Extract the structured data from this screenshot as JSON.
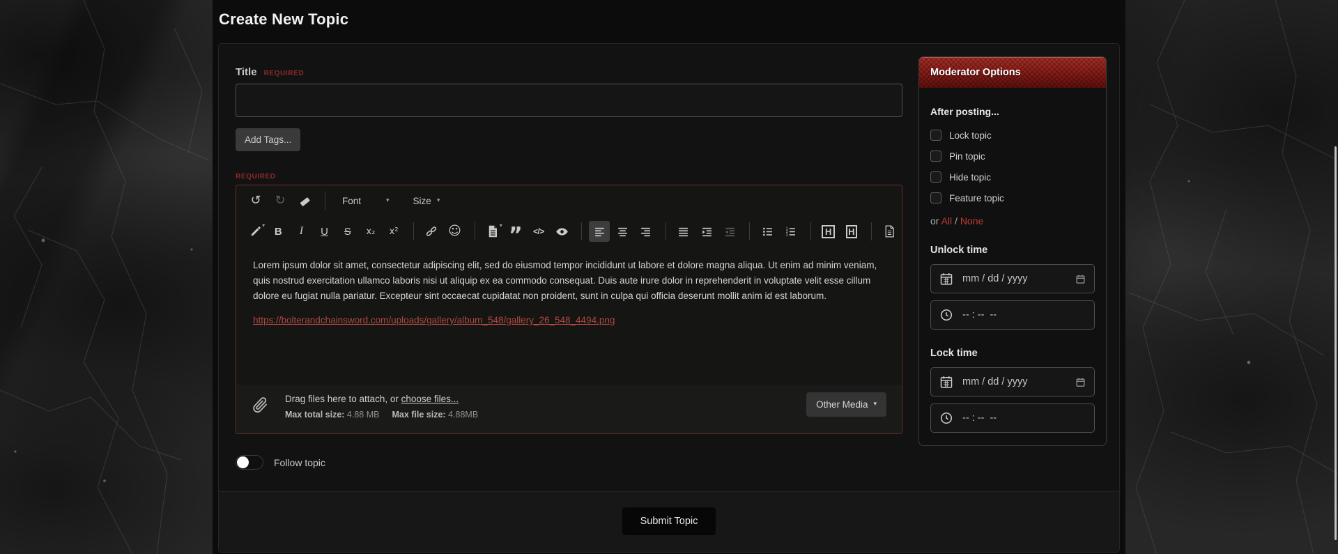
{
  "page": {
    "title": "Create New Topic"
  },
  "icons": {
    "caret_glyph": "▾",
    "undo_glyph": "↺",
    "redo_glyph": "↻",
    "emoji_glyph": "☺",
    "quote_glyph": "”"
  },
  "form": {
    "title_label": "Title",
    "required_label": "REQUIRED",
    "add_tags_label": "Add Tags...",
    "editor": {
      "required_label": "REQUIRED",
      "toolbar": {
        "font_label": "Font",
        "size_label": "Size",
        "bold_label": "B",
        "italic_label": "I",
        "underline_label": "U",
        "strike_label": "S",
        "subscript_label": "x₂",
        "superscript_label": "x²",
        "code_label": "</>",
        "header_label": "H",
        "icon_names": [
          "undo",
          "redo",
          "remove-format",
          "text-color",
          "bold",
          "italic",
          "underline",
          "strikethrough",
          "subscript",
          "superscript",
          "link",
          "emoji",
          "insert-page",
          "quote",
          "code",
          "preview-eye",
          "align-left",
          "align-center",
          "align-right",
          "align-justify",
          "indent",
          "outdent",
          "list-unordered",
          "list-ordered",
          "header-box",
          "header-box-alt",
          "source-page"
        ]
      },
      "content": {
        "paragraph": "Lorem ipsum dolor sit amet, consectetur adipiscing elit, sed do eiusmod tempor incididunt ut labore et dolore magna aliqua. Ut enim ad minim veniam, quis nostrud exercitation ullamco laboris nisi ut aliquip ex ea commodo consequat. Duis aute irure dolor in reprehenderit in voluptate velit esse cillum dolore eu fugiat nulla pariatur. Excepteur sint occaecat cupidatat non proident, sunt in culpa qui officia deserunt mollit anim id est laborum.",
        "link_text": "https://bolterandchainsword.com/uploads/gallery/album_548/gallery_26_548_4494.png"
      },
      "attach": {
        "drag_text": "Drag files here to attach, or ",
        "choose_files_label": "choose files...",
        "max_total_label": "Max total size:",
        "max_total_value": "4.88 MB",
        "max_file_label": "Max file size:",
        "max_file_value": "4.88MB",
        "other_media_label": "Other Media"
      }
    },
    "follow_topic_label": "Follow topic",
    "submit_label": "Submit Topic"
  },
  "moderator": {
    "header": "Moderator Options",
    "after_posting_label": "After posting...",
    "checkboxes": [
      {
        "label": "Lock topic",
        "checked": false
      },
      {
        "label": "Pin topic",
        "checked": false
      },
      {
        "label": "Hide topic",
        "checked": false
      },
      {
        "label": "Feature topic",
        "checked": false
      }
    ],
    "or_label": "or ",
    "all_label": "All",
    "separator": " / ",
    "none_label": "None",
    "unlock_time_label": "Unlock time",
    "lock_time_label": "Lock time",
    "date_placeholder": "mm / dd / yyyy",
    "time_placeholder": "-- : --  --"
  },
  "colors": {
    "accent_red": "#8c1d18",
    "required_red": "#8f2a2a",
    "link_red": "#b0493f",
    "editor_border_red": "#6e2d28"
  }
}
